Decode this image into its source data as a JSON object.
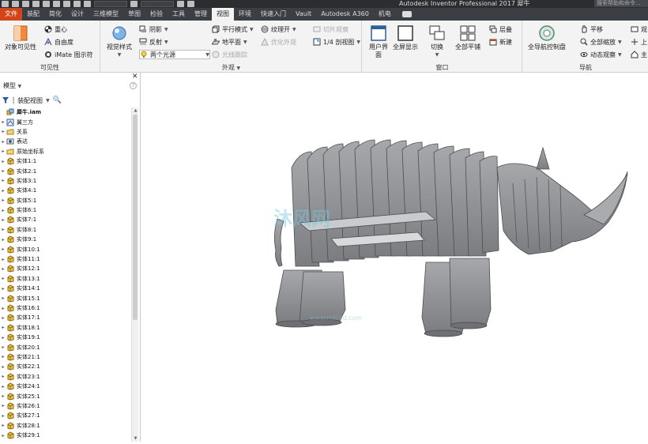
{
  "titlebar": {
    "app_title": "Autodesk Inventor Professional 2017   犀牛",
    "help_search_placeholder": "搜索帮助和命令..."
  },
  "tabs": [
    {
      "label": "文件"
    },
    {
      "label": "装配"
    },
    {
      "label": "简化"
    },
    {
      "label": "设计"
    },
    {
      "label": "三维模型"
    },
    {
      "label": "草图"
    },
    {
      "label": "检验"
    },
    {
      "label": "工具"
    },
    {
      "label": "管理"
    },
    {
      "label": "视图"
    },
    {
      "label": "环境"
    },
    {
      "label": "快速入门"
    },
    {
      "label": "Vault"
    },
    {
      "label": "Autodesk A360"
    },
    {
      "label": "机电"
    }
  ],
  "ribbon": {
    "visibility": {
      "label": "可见性",
      "object_visibility": "对象可见性",
      "center_of_gravity": "重心",
      "dof": "自由度",
      "imate_glyph": "iMate 图示符"
    },
    "appearance": {
      "label": "外观",
      "visual_style": "视觉样式",
      "shadows": "阴影",
      "reflections": "反射",
      "lighting": "两个光源",
      "ortho": "平行模式",
      "ground_plane": "地平面",
      "ray_tracing": "光线跟踪",
      "texture": "纹理开",
      "optimize": "优化外观",
      "slice": "切片观察",
      "quarter_section": "1/4 剖视图"
    },
    "windows": {
      "label": "窗口",
      "user_interface": "用户界面",
      "full_screen": "全屏显示",
      "switch": "切换",
      "tile": "全部平铺",
      "cascade": "层叠",
      "new": "新建"
    },
    "navigate": {
      "label": "导航",
      "steering_wheels": "全导航控制盘",
      "pan": "平移",
      "zoom_all": "全部缩放",
      "orbit": "动态观察",
      "look_at": "观",
      "up": "上",
      "home": "主"
    }
  },
  "browser": {
    "title": "模型",
    "view_mode": "装配视图",
    "root": "犀牛.iam",
    "items": [
      "翼三方",
      "关系",
      "表达",
      "原始坐标系",
      "实体1:1",
      "实体2:1",
      "实体3:1",
      "实体4:1",
      "实体5:1",
      "实体6:1",
      "实体7:1",
      "实体8:1",
      "实体9:1",
      "实体10:1",
      "实体11:1",
      "实体12:1",
      "实体13:1",
      "实体14:1",
      "实体15:1",
      "实体16:1",
      "实体17:1",
      "实体18:1",
      "实体19:1",
      "实体20:1",
      "实体21:1",
      "实体22:1",
      "实体23:1",
      "实体24:1",
      "实体25:1",
      "实体26:1",
      "实体27:1",
      "实体28:1",
      "实体29:1"
    ]
  },
  "viewport": {
    "watermark": "沐风网",
    "watermark_url": "www.mfcad.com"
  },
  "colors": {
    "file_tab": "#d2451a",
    "tab_bar": "#3b3e43",
    "ribbon_bg": "#f3f3f3",
    "model_fill": "#8f9195"
  }
}
